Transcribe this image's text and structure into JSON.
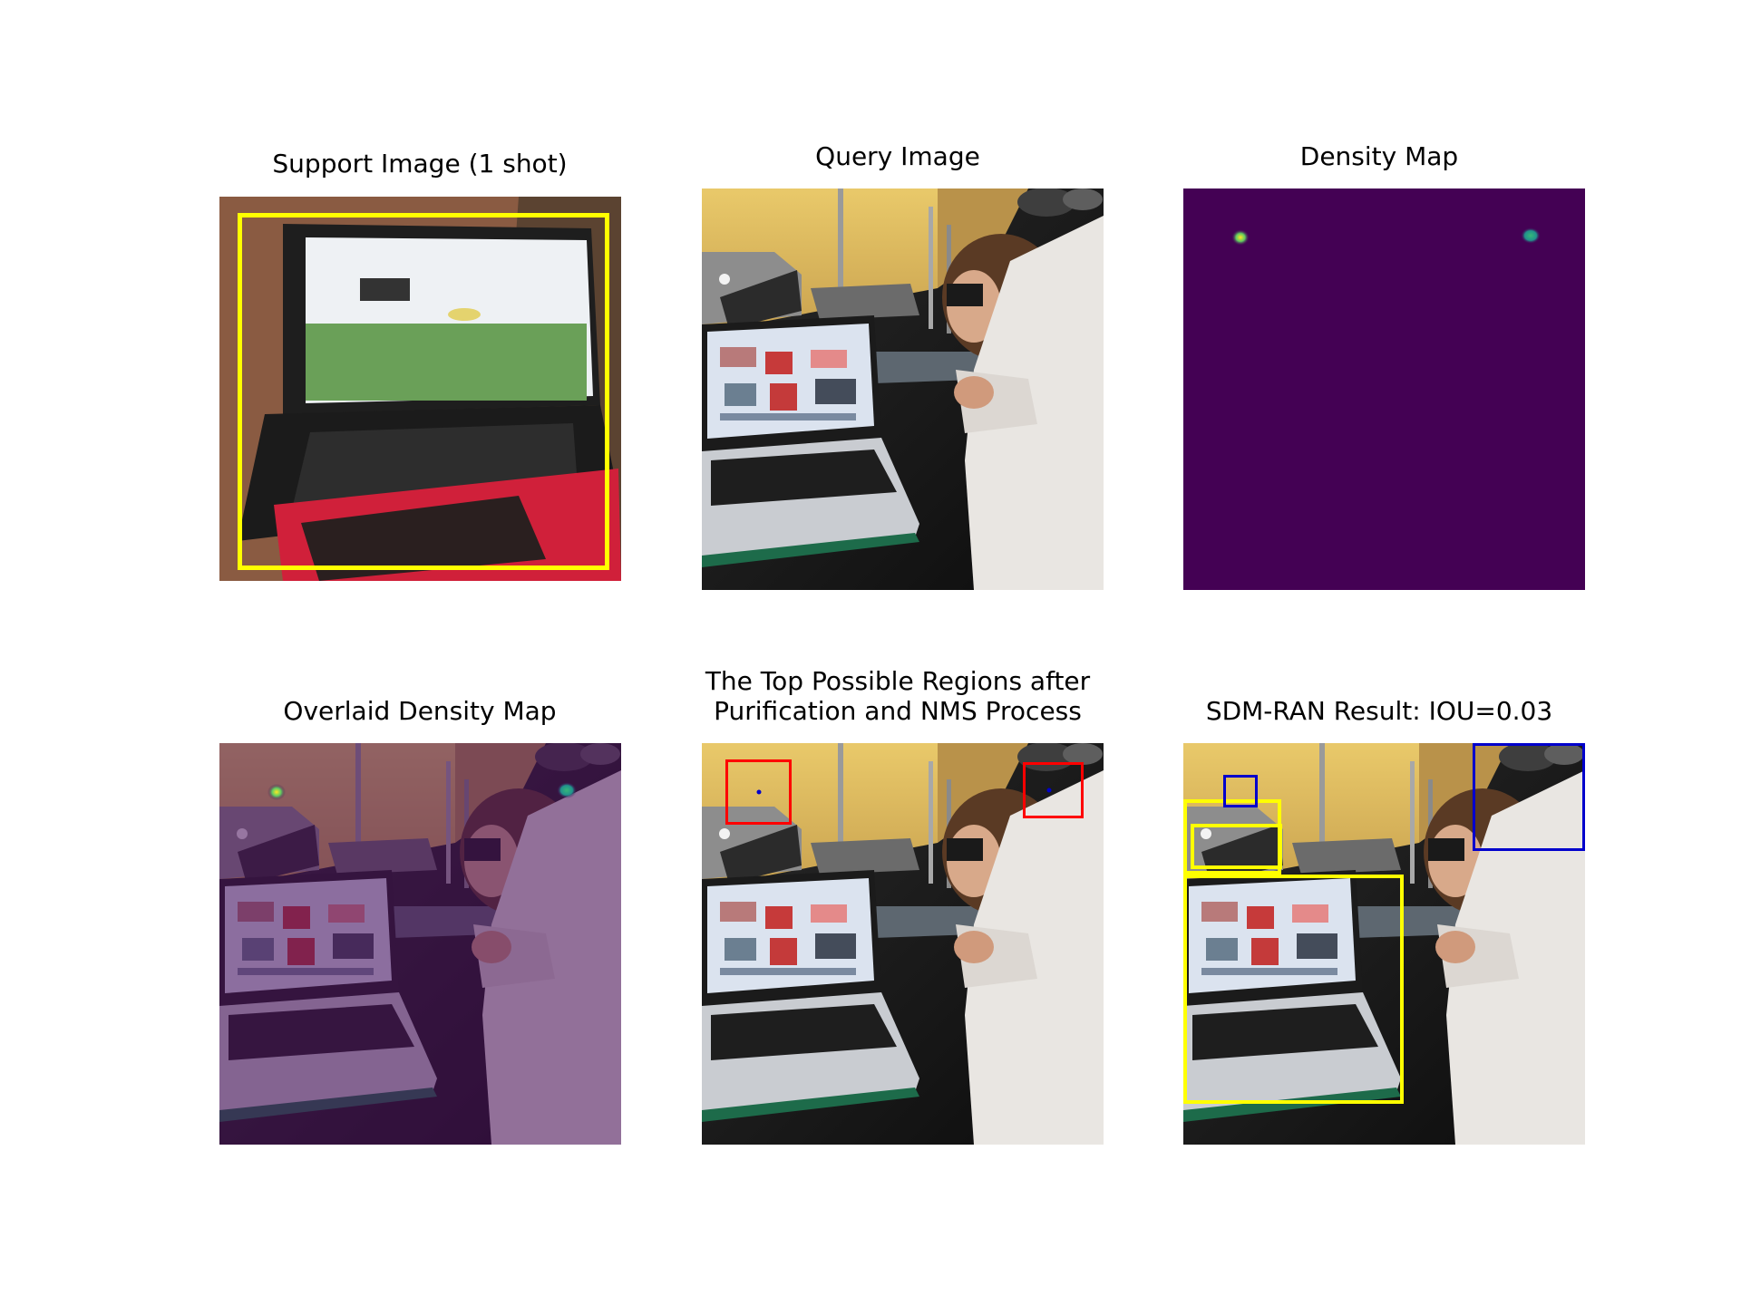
{
  "figure": {
    "panels": [
      {
        "id": "support",
        "title": "Support Image (1 shot)",
        "content": "laptop photograph with yellow bounding box"
      },
      {
        "id": "query",
        "title": "Query Image",
        "content": "lab photograph with laptops and student at microscope"
      },
      {
        "id": "density",
        "title": "Density Map",
        "content": "dark purple map with two small bright spots"
      },
      {
        "id": "overlay",
        "title": "Overlaid Density Map",
        "content": "query photo tinted purple with density spots"
      },
      {
        "id": "regions",
        "title": "The Top Possible Regions after\nPurification and NMS Process",
        "content": "query photo with two red candidate boxes"
      },
      {
        "id": "result",
        "title": "SDM-RAN Result: IOU=0.03",
        "content": "query photo with yellow ground-truth boxes and blue predicted boxes"
      }
    ],
    "colors": {
      "ground_truth_box": "#ffff00",
      "candidate_box": "#ff0000",
      "predicted_box": "#0000cc",
      "density_background": "#440154",
      "overlay_tint": "#5a2a6a"
    }
  }
}
